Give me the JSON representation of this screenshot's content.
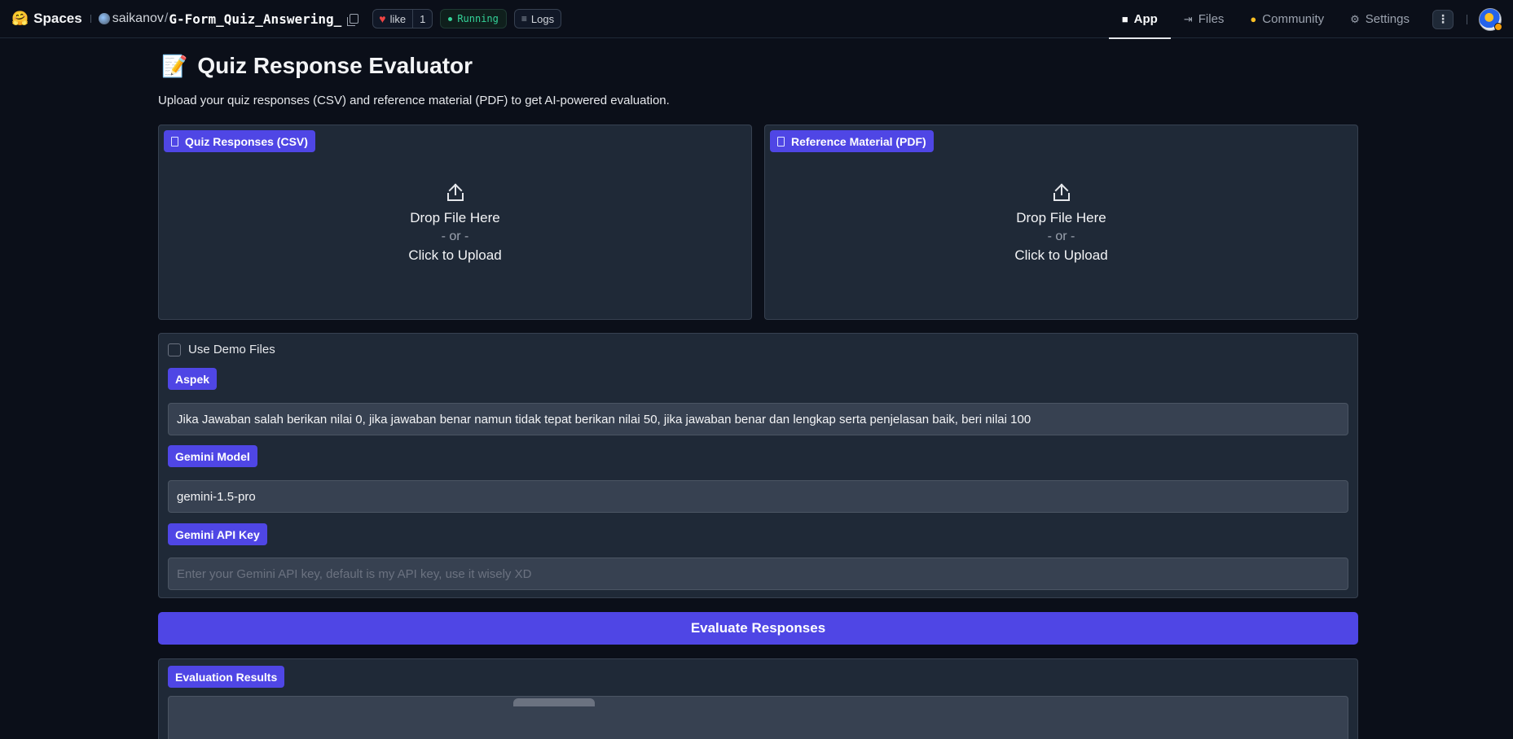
{
  "topbar": {
    "brand": "Spaces",
    "owner": "saikanov",
    "separator": "/",
    "repo": "G-Form_Quiz_Answering_",
    "like_label": "like",
    "like_count": "1",
    "status": "Running",
    "logs_label": "Logs",
    "nav": [
      {
        "label": "App",
        "icon": "cube-icon",
        "active": true
      },
      {
        "label": "Files",
        "icon": "files-icon",
        "active": false
      },
      {
        "label": "Community",
        "icon": "community-icon",
        "active": false
      },
      {
        "label": "Settings",
        "icon": "gear-icon",
        "active": false
      }
    ]
  },
  "main": {
    "title": "Quiz Response Evaluator",
    "subtitle": "Upload your quiz responses (CSV) and reference material (PDF) to get AI-powered evaluation.",
    "uploads": [
      {
        "label": "Quiz Responses (CSV)",
        "drop": "Drop File Here",
        "or": "- or -",
        "click": "Click to Upload"
      },
      {
        "label": "Reference Material (PDF)",
        "drop": "Drop File Here",
        "or": "- or -",
        "click": "Click to Upload"
      }
    ],
    "demo_label": "Use Demo Files",
    "demo_checked": false,
    "aspek": {
      "label": "Aspek",
      "value": "Jika Jawaban salah berikan nilai 0, jika jawaban benar namun tidak tepat berikan nilai 50, jika jawaban benar dan lengkap serta penjelasan baik, beri nilai 100"
    },
    "model": {
      "label": "Gemini Model",
      "value": "gemini-1.5-pro"
    },
    "api_key": {
      "label": "Gemini API Key",
      "value": "",
      "placeholder": "Enter your Gemini API key, default is my API key, use it wisely XD"
    },
    "evaluate_label": "Evaluate Responses",
    "results_label": "Evaluation Results"
  },
  "colors": {
    "accent": "#4f46e5",
    "background": "#0b0f19",
    "panel": "#1f2937",
    "input": "#374151",
    "running": "#34d399",
    "heart": "#ef4444"
  }
}
